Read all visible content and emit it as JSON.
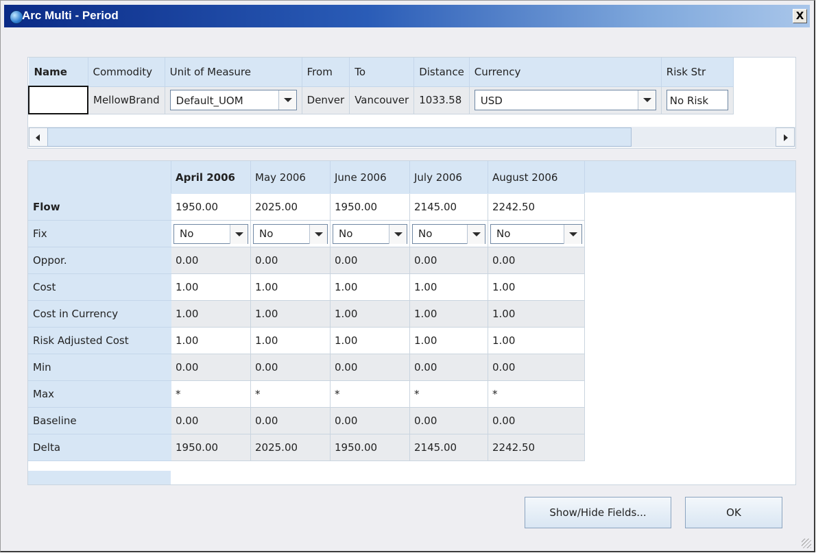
{
  "window": {
    "title": "Arc Multi - Period",
    "close_label": "X"
  },
  "arc_header": {
    "columns": [
      "Name",
      "Commodity",
      "Unit of Measure",
      "From",
      "To",
      "Distance",
      "Currency",
      "Risk Str"
    ],
    "values": {
      "name": "",
      "commodity": "MellowBrand",
      "uom": "Default_UOM",
      "from": "Denver",
      "to": "Vancouver",
      "distance": "1033.58",
      "currency": "USD",
      "risk": "No Risk"
    }
  },
  "period_grid": {
    "periods": [
      "April 2006",
      "May 2006",
      "June 2006",
      "July 2006",
      "August 2006"
    ],
    "rows": [
      {
        "label": "Flow",
        "values": [
          "1950.00",
          "2025.00",
          "1950.00",
          "2145.00",
          "2242.50"
        ]
      },
      {
        "label": "Fix",
        "values": [
          "No",
          "No",
          "No",
          "No",
          "No"
        ]
      },
      {
        "label": "Oppor.",
        "values": [
          "0.00",
          "0.00",
          "0.00",
          "0.00",
          "0.00"
        ]
      },
      {
        "label": "Cost",
        "values": [
          "1.00",
          "1.00",
          "1.00",
          "1.00",
          "1.00"
        ]
      },
      {
        "label": "Cost in Currency",
        "values": [
          "1.00",
          "1.00",
          "1.00",
          "1.00",
          "1.00"
        ]
      },
      {
        "label": "Risk Adjusted Cost",
        "values": [
          "1.00",
          "1.00",
          "1.00",
          "1.00",
          "1.00"
        ]
      },
      {
        "label": "Min",
        "values": [
          "0.00",
          "0.00",
          "0.00",
          "0.00",
          "0.00"
        ]
      },
      {
        "label": "Max",
        "values": [
          "*",
          "*",
          "*",
          "*",
          "*"
        ]
      },
      {
        "label": "Baseline",
        "values": [
          "0.00",
          "0.00",
          "0.00",
          "0.00",
          "0.00"
        ]
      },
      {
        "label": "Delta",
        "values": [
          "1950.00",
          "2025.00",
          "1950.00",
          "2145.00",
          "2242.50"
        ]
      }
    ]
  },
  "buttons": {
    "show_hide": "Show/Hide Fields...",
    "ok": "OK"
  },
  "colors": {
    "title_gradient_start": "#0a2a86",
    "header_bg": "#d7e6f5",
    "alt_row": "#e9ebee"
  }
}
